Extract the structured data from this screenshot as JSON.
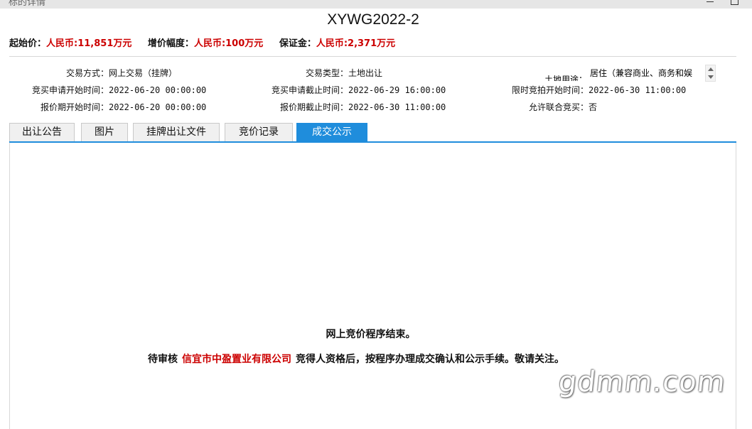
{
  "window": {
    "title": "标的详情"
  },
  "header": {
    "title": "XYWG2022-2"
  },
  "prices": {
    "start_label": "起始价：",
    "start_value": "人民币:11,851万元",
    "increment_label": "增价幅度：",
    "increment_value": "人民币:100万元",
    "deposit_label": "保证金：",
    "deposit_value": "人民币:2,371万元"
  },
  "info": {
    "trade_mode_label": "交易方式：",
    "trade_mode_value": "网上交易（挂牌）",
    "trade_type_label": "交易类型：",
    "trade_type_value": "土地出让",
    "land_use_label": "土地用途：",
    "land_use_value": "居住（兼容商业、商务和娱",
    "apply_start_label": "竞买申请开始时间：",
    "apply_start_value": "2022-06-20 00:00:00",
    "apply_end_label": "竞买申请截止时间：",
    "apply_end_value": "2022-06-29 16:00:00",
    "timed_bid_start_label": "限时竞拍开始时间：",
    "timed_bid_start_value": "2022-06-30 11:00:00",
    "quote_start_label": "报价期开始时间：",
    "quote_start_value": "2022-06-20 00:00:00",
    "quote_end_label": "报价期截止时间：",
    "quote_end_value": "2022-06-30 11:00:00",
    "joint_bid_label": "允许联合竞买：",
    "joint_bid_value": "否"
  },
  "tabs": [
    {
      "label": "出让公告"
    },
    {
      "label": "图片"
    },
    {
      "label": "挂牌出让文件"
    },
    {
      "label": "竞价记录"
    },
    {
      "label": "成交公示",
      "active": true
    }
  ],
  "result": {
    "line1": "网上竞价程序结束。",
    "line2_prefix": "待审核",
    "company": "信宜市中盈置业有限公司",
    "line2_suffix": "竞得人资格后，按程序办理成交确认和公示手续。敬请关注。"
  },
  "watermark": "gdmm.com",
  "colors": {
    "accent": "#1f8ddc",
    "highlight_red": "#cc0000"
  }
}
